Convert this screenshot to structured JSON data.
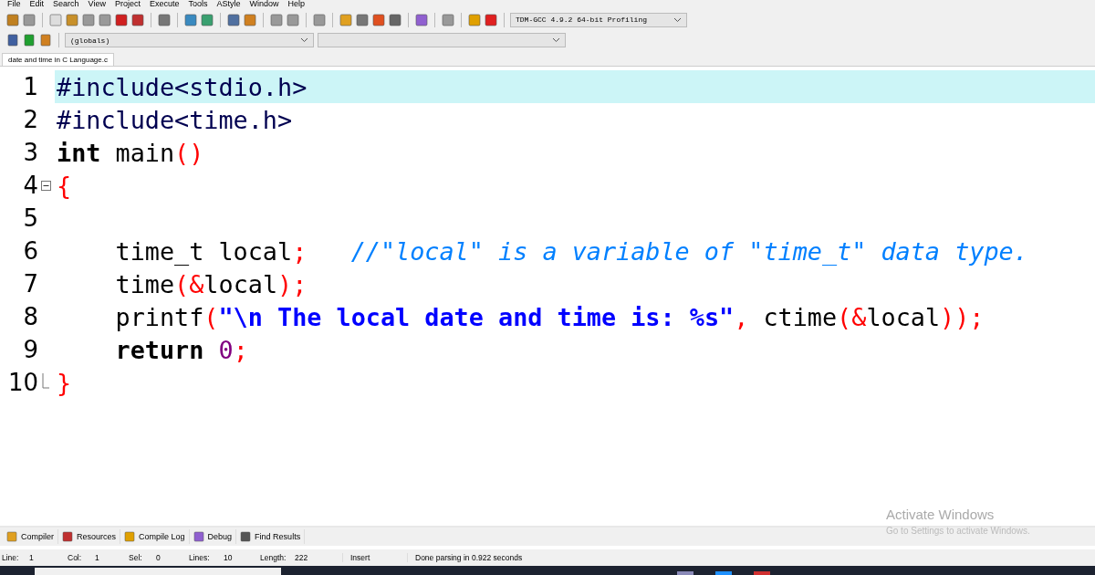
{
  "menu": [
    "File",
    "Edit",
    "Search",
    "View",
    "Project",
    "Execute",
    "Tools",
    "AStyle",
    "Window",
    "Help"
  ],
  "compiler_select": {
    "value": "TDM-GCC 4.9.2 64-bit Profiling"
  },
  "scope_select": {
    "value": "(globals)"
  },
  "tabs": [
    {
      "label": "date and time in C Language.c",
      "selected": true
    }
  ],
  "editor": {
    "lines": [
      {
        "number": "1",
        "selected": true,
        "fold_start": false,
        "fold_end": false,
        "tokens": [
          {
            "kind": "pre",
            "text": "#include<stdio.h>"
          }
        ]
      },
      {
        "number": "2",
        "selected": false,
        "fold_start": false,
        "fold_end": false,
        "tokens": [
          {
            "kind": "pre",
            "text": "#include<time.h>"
          }
        ]
      },
      {
        "number": "3",
        "selected": false,
        "fold_start": false,
        "fold_end": false,
        "tokens": [
          {
            "kind": "keyword",
            "text": "int"
          },
          {
            "kind": "plain",
            "text": " main"
          },
          {
            "kind": "symbol",
            "text": "()"
          }
        ]
      },
      {
        "number": "4",
        "selected": false,
        "fold_start": true,
        "fold_end": false,
        "tokens": [
          {
            "kind": "symbol",
            "text": "{"
          }
        ]
      },
      {
        "number": "5",
        "selected": false,
        "fold_start": false,
        "fold_end": false
      },
      {
        "number": "6",
        "selected": false,
        "fold_start": false,
        "fold_end": false,
        "tokens": [
          {
            "kind": "plain",
            "text": "    time_t local"
          },
          {
            "kind": "symbol",
            "text": ";"
          },
          {
            "kind": "comment",
            "text": "   //\"local\" is a variable of \"time_t\" data type."
          }
        ]
      },
      {
        "number": "7",
        "selected": false,
        "fold_start": false,
        "fold_end": false,
        "tokens": [
          {
            "kind": "plain",
            "text": "    time"
          },
          {
            "kind": "symbol",
            "text": "(&"
          },
          {
            "kind": "plain",
            "text": "local"
          },
          {
            "kind": "symbol",
            "text": ");"
          }
        ]
      },
      {
        "number": "8",
        "selected": false,
        "fold_start": false,
        "fold_end": false,
        "tokens": [
          {
            "kind": "plain",
            "text": "    printf"
          },
          {
            "kind": "symbol",
            "text": "("
          },
          {
            "kind": "string",
            "text": "\"\\n The local date and time is: %s\""
          },
          {
            "kind": "symbol",
            "text": ","
          },
          {
            "kind": "plain",
            "text": " ctime"
          },
          {
            "kind": "symbol",
            "text": "(&"
          },
          {
            "kind": "plain",
            "text": "local"
          },
          {
            "kind": "symbol",
            "text": "));"
          }
        ]
      },
      {
        "number": "9",
        "selected": false,
        "fold_start": false,
        "fold_end": false,
        "tokens": [
          {
            "kind": "keyword",
            "text": "    return"
          },
          {
            "kind": "number",
            "text": " 0"
          },
          {
            "kind": "symbol",
            "text": ";"
          }
        ]
      },
      {
        "number": "10",
        "selected": false,
        "fold_start": false,
        "fold_end": true,
        "tokens": [
          {
            "kind": "symbol",
            "text": "}"
          }
        ]
      }
    ]
  },
  "bottom_tabs": [
    "Compiler",
    "Resources",
    "Compile Log",
    "Debug",
    "Find Results"
  ],
  "status_bar": {
    "fields": [
      {
        "label": "Line:",
        "value": "1"
      },
      {
        "label": "Col:",
        "value": "1"
      },
      {
        "label": "Sel:",
        "value": "0"
      },
      {
        "label": "Lines:",
        "value": "10"
      },
      {
        "label": "Length:",
        "value": "222"
      }
    ],
    "mode": "Insert",
    "message": "Done parsing in 0.922 seconds"
  },
  "activation_notice": {
    "title": "Activate Windows",
    "text": "Go to Settings to activate Windows."
  }
}
